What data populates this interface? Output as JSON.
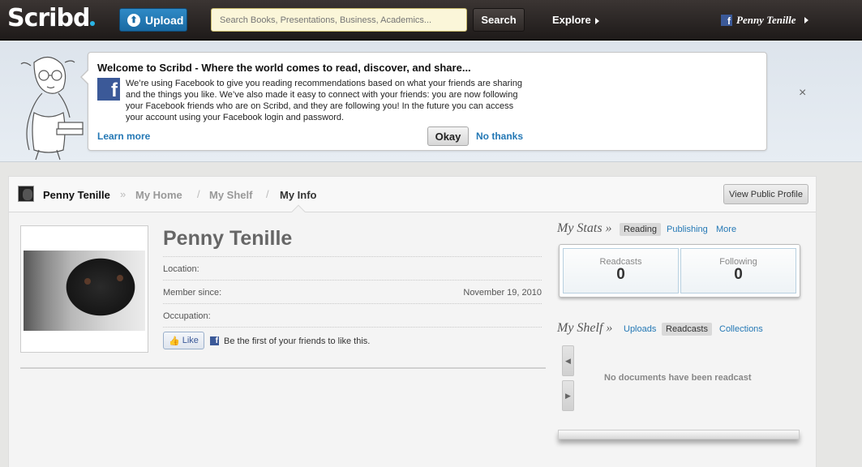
{
  "topbar": {
    "logo": "Scribd",
    "upload_label": "Upload",
    "search_placeholder": "Search Books, Presentations, Business, Academics...",
    "search_button": "Search",
    "explore_label": "Explore",
    "user_name": "Penny Tenille"
  },
  "welcome": {
    "title": "Welcome to Scribd - Where the world comes to read, discover, and share...",
    "body": "We’re using Facebook to give you reading recommendations based on what your friends are sharing and the things you like. We’ve also made it easy to connect with your friends: you are now following your Facebook friends who are on Scribd, and they are following you! In the future you can access your account using your Facebook login and password.",
    "learn_more": "Learn more",
    "okay": "Okay",
    "no_thanks": "No thanks",
    "close": "×"
  },
  "nav": {
    "name": "Penny Tenille",
    "sep1": "»",
    "my_home": "My Home",
    "sep2": "/",
    "my_shelf": "My Shelf",
    "sep3": "/",
    "my_info": "My Info",
    "view_public_profile": "View Public Profile"
  },
  "profile": {
    "name": "Penny Tenille",
    "location_label": "Location:",
    "location_value": "",
    "member_since_label": "Member since:",
    "member_since_value": "November 19, 2010",
    "occupation_label": "Occupation:",
    "occupation_value": "",
    "like_label": "Like",
    "like_text": "Be the first of your friends to like this."
  },
  "stats": {
    "heading": "My Stats »",
    "tabs": [
      "Reading",
      "Publishing",
      "More"
    ],
    "readcasts_label": "Readcasts",
    "readcasts_value": "0",
    "following_label": "Following",
    "following_value": "0"
  },
  "shelf": {
    "heading": "My Shelf »",
    "tabs": [
      "Uploads",
      "Readcasts",
      "Collections"
    ],
    "empty_message": "No documents have been readcast",
    "prev": "◀",
    "next": "▶"
  },
  "colors": {
    "link": "#2478b5",
    "facebook": "#3b5998",
    "upload_button": "#1a6aa3",
    "topbar": "#2a2523"
  }
}
